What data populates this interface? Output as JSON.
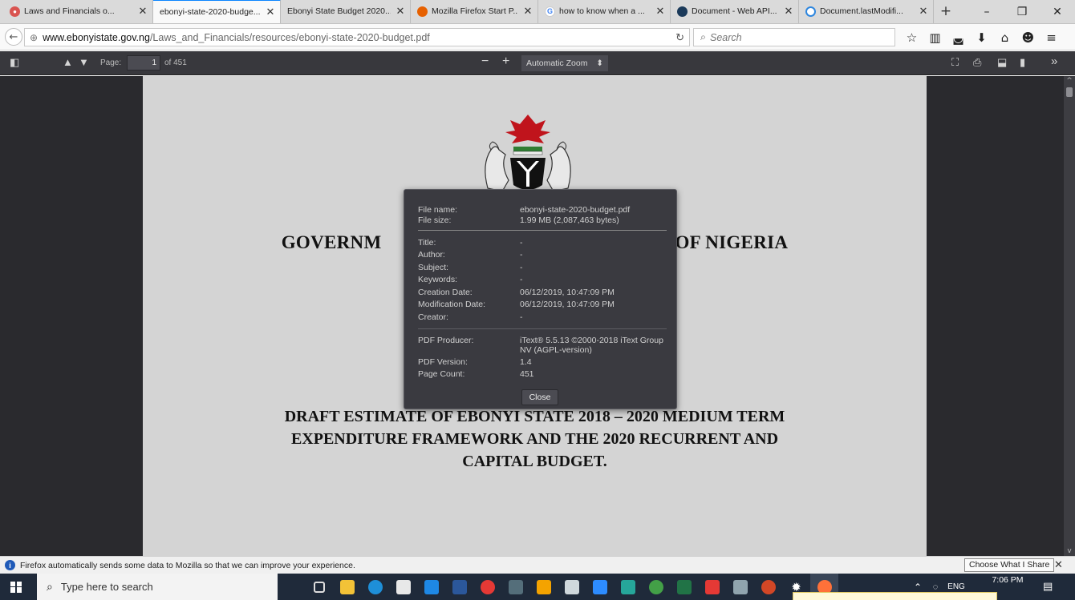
{
  "tabs": [
    {
      "title": "Laws and Financials o...",
      "icon": "tab-favicon-red-icon",
      "color": "#d9534f"
    },
    {
      "title": "ebonyi-state-2020-budge...",
      "icon": "none",
      "color": "",
      "active": true
    },
    {
      "title": "Ebonyi State Budget 2020...",
      "icon": "none",
      "color": ""
    },
    {
      "title": "Mozilla Firefox Start P...",
      "icon": "firefox-icon",
      "color": "#e66000"
    },
    {
      "title": "how to know when a ...",
      "icon": "google-icon",
      "color": "#4285f4"
    },
    {
      "title": "Document - Web API...",
      "icon": "mdn-icon",
      "color": "#1b3a5a"
    },
    {
      "title": "Document.lastModifi...",
      "icon": "loading-icon",
      "color": "#2e86de"
    }
  ],
  "urlbar": {
    "domain": "www.ebonyistate.gov.ng",
    "path": "/Laws_and_Financials/resources/ebonyi-state-2020-budget.pdf"
  },
  "search": {
    "placeholder": "Search"
  },
  "pdf_toolbar": {
    "page_label": "Page:",
    "page_value": "1",
    "page_of": "of 451",
    "zoom_label": "Automatic Zoom"
  },
  "document": {
    "heading_left": "GOVERNM",
    "heading_right": "OF NIGERIA",
    "draft_lines": [
      "DRAFT ESTIMATE OF EBONYI STATE 2018 – 2020 MEDIUM TERM",
      "EXPENDITURE FRAMEWORK AND THE 2020 RECURRENT AND",
      "CAPITAL BUDGET."
    ]
  },
  "dialog": {
    "file_name_label": "File name:",
    "file_name": "ebonyi-state-2020-budget.pdf",
    "file_size_label": "File size:",
    "file_size": "1.99 MB (2,087,463 bytes)",
    "title_label": "Title:",
    "title": "-",
    "author_label": "Author:",
    "author": "-",
    "subject_label": "Subject:",
    "subject": "-",
    "keywords_label": "Keywords:",
    "keywords": "-",
    "creation_label": "Creation Date:",
    "creation": "06/12/2019, 10:47:09 PM",
    "modification_label": "Modification Date:",
    "modification": "06/12/2019, 10:47:09 PM",
    "creator_label": "Creator:",
    "creator": "-",
    "producer_label": "PDF Producer:",
    "producer": "iText® 5.5.13 ©2000-2018 iText Group NV (AGPL-version)",
    "version_label": "PDF Version:",
    "version": "1.4",
    "pagecount_label": "Page Count:",
    "pagecount": "451",
    "close_label": "Close"
  },
  "notification": {
    "message": "Firefox automatically sends some data to Mozilla so that we can improve your experience.",
    "button_label": "Choose What I Share"
  },
  "taskbar": {
    "search_placeholder": "Type here to search",
    "tray_lang": "ENG",
    "clock_time": "7:06 PM"
  }
}
